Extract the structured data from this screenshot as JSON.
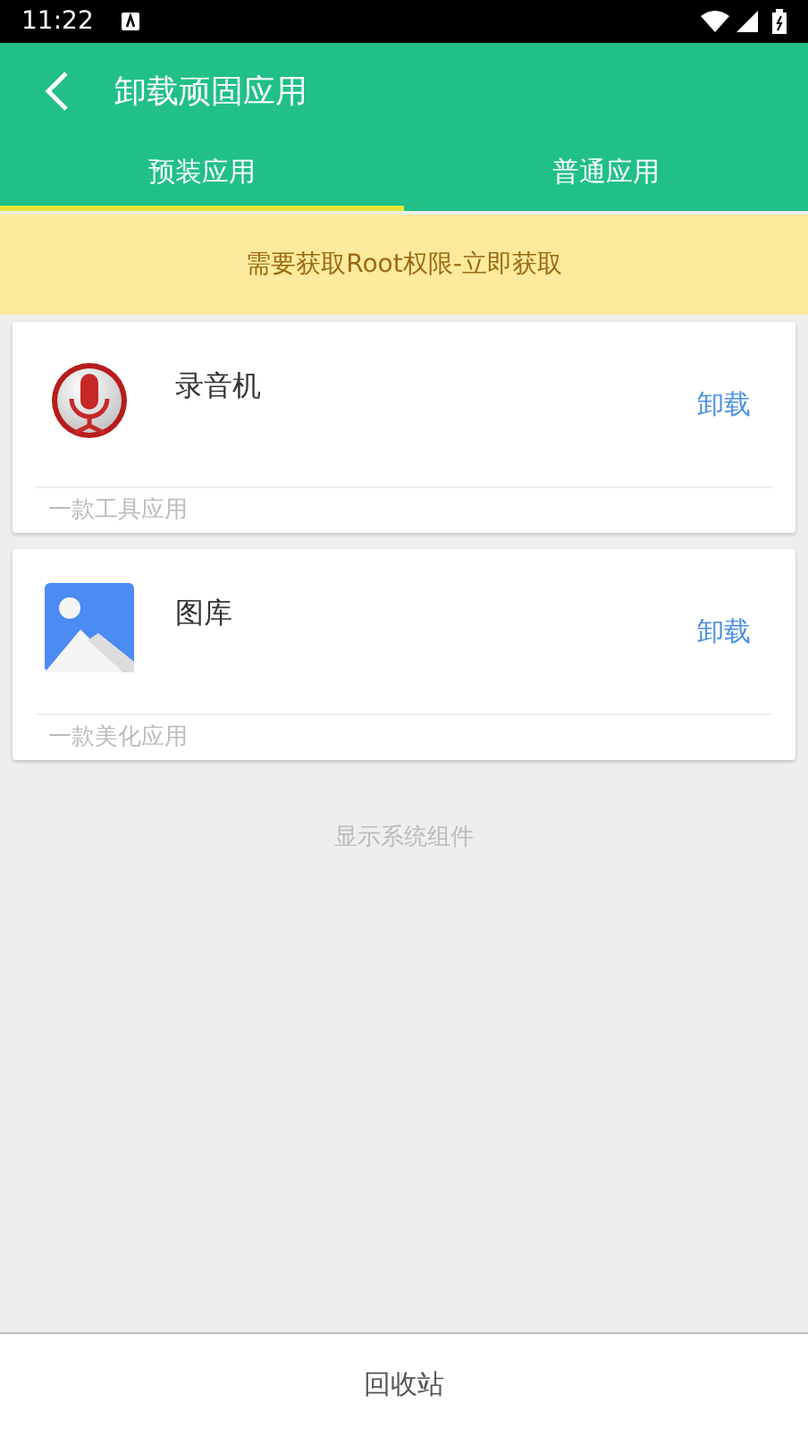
{
  "status_bar": {
    "time": "11:22"
  },
  "app_bar": {
    "title": "卸载顽固应用"
  },
  "tabs": [
    {
      "label": "预装应用",
      "selected": true
    },
    {
      "label": "普通应用",
      "selected": false
    }
  ],
  "banner": {
    "text": "需要获取Root权限-立即获取"
  },
  "apps": [
    {
      "kind": "recorder",
      "name": "录音机",
      "action": "卸载",
      "description": "一款工具应用"
    },
    {
      "kind": "gallery",
      "name": "图库",
      "action": "卸载",
      "description": "一款美化应用"
    }
  ],
  "system_toggle": "显示系统组件",
  "bottom_bar": {
    "label": "回收站"
  }
}
